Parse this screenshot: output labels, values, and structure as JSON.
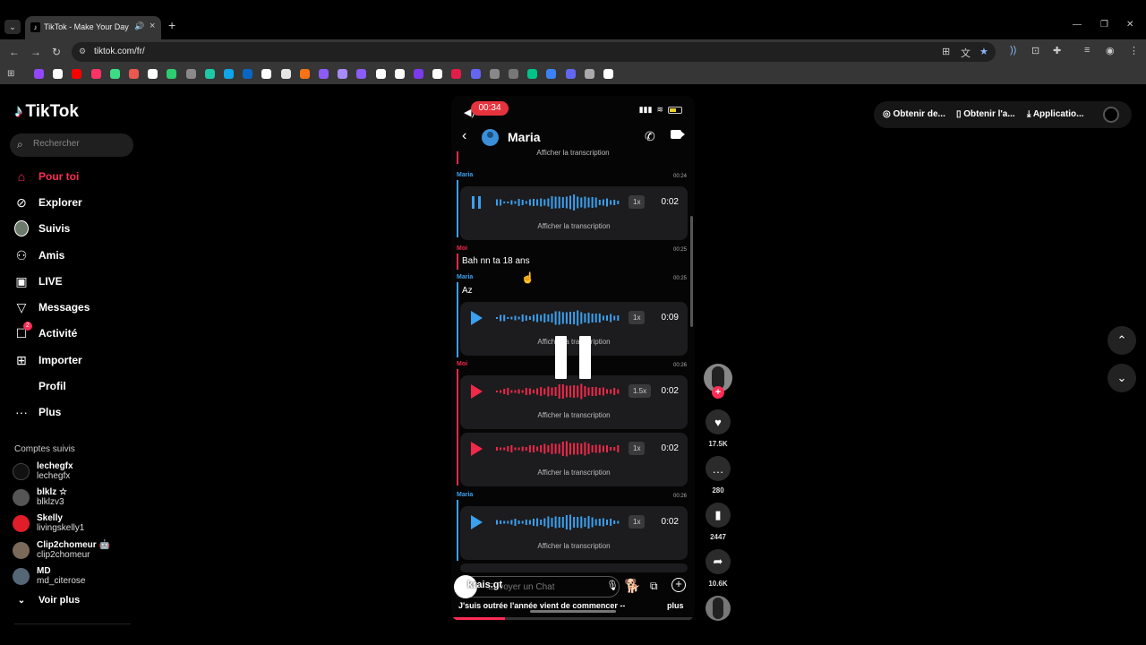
{
  "browser": {
    "tab_title": "TikTok - Make Your Day",
    "url": "tiktok.com/fr/",
    "bookmark_colors": [
      "#9147ff",
      "#ffffff",
      "#ff0000",
      "#ff3366",
      "#3ddc84",
      "#e95950",
      "#ffffff",
      "#2ecc71",
      "#8a8a8a",
      "#1ec8a5",
      "#0ea5e9",
      "#0a66c2",
      "#ffffff",
      "#e5e5e5",
      "#f97316",
      "#8b5cf6",
      "#a78bfa",
      "#8b5cf6",
      "#ffffff",
      "#ffffff",
      "#7c3aed",
      "#ffffff",
      "#e11d48",
      "#6366f1",
      "#888888",
      "#777777",
      "#00c389",
      "#3b82f6",
      "#6366f1",
      "#aaaaaa",
      "#ffffff"
    ]
  },
  "sidebar": {
    "logo": "TikTok",
    "search_placeholder": "Rechercher",
    "nav": [
      {
        "label": "Pour toi",
        "icon": "home-icon"
      },
      {
        "label": "Explorer",
        "icon": "compass-icon"
      },
      {
        "label": "Suivis",
        "icon": "following-avatar-icon"
      },
      {
        "label": "Amis",
        "icon": "friends-icon"
      },
      {
        "label": "LIVE",
        "icon": "live-icon"
      },
      {
        "label": "Messages",
        "icon": "messages-icon"
      },
      {
        "label": "Activité",
        "icon": "activity-icon",
        "badge": "2"
      },
      {
        "label": "Importer",
        "icon": "upload-icon"
      },
      {
        "label": "Profil",
        "icon": "profile-icon"
      },
      {
        "label": "Plus",
        "icon": "more-icon"
      }
    ],
    "following_title": "Comptes suivis",
    "following": [
      {
        "display": "lechegfx",
        "username": "lechegfx",
        "color": "#111111"
      },
      {
        "display": "blklz ☆",
        "username": "blklzv3",
        "color": "#555555"
      },
      {
        "display": "Skelly",
        "username": "livingskelly1",
        "color": "#e11d2a"
      },
      {
        "display": "Clip2chomeur 🤖",
        "username": "clip2chomeur",
        "color": "#7a6a5a"
      },
      {
        "display": "MD",
        "username": "md_citerose",
        "color": "#556677"
      }
    ],
    "see_more": "Voir plus"
  },
  "video": {
    "recording_time": "00:34",
    "contact_name": "Maria",
    "transcript_label": "Afficher la transcription",
    "text_messages": {
      "moi_1": "Bah nn ta 18 ans",
      "maria_1": "Az"
    },
    "labels": {
      "maria": "Maria",
      "moi": "Moi"
    },
    "times": {
      "t1": "00:24",
      "t2": "00:25",
      "t3": "00:25",
      "t4": "00:26",
      "t5": "00:26"
    },
    "voice_notes": [
      {
        "sender": "maria",
        "speed": "1x",
        "duration": "0:02",
        "state": "playing"
      },
      {
        "sender": "maria",
        "speed": "1x",
        "duration": "0:09",
        "state": "paused"
      },
      {
        "sender": "moi",
        "speed": "1.5x",
        "duration": "0:02",
        "state": "paused"
      },
      {
        "sender": "moi",
        "speed": "1x",
        "duration": "0:02",
        "state": "paused"
      },
      {
        "sender": "maria",
        "speed": "1x",
        "duration": "0:02",
        "state": "paused"
      }
    ],
    "chat_placeholder": "Envoyer un Chat",
    "author": "krais.gt",
    "caption": "J'suis outrée l'année vient de commencer --",
    "more": "plus",
    "progress": 0.22,
    "colors": {
      "maria": "#3aa0f0",
      "moi": "#f0284a"
    }
  },
  "actions": {
    "likes": "17.5K",
    "comments": "280",
    "saves": "2447",
    "shares": "10.6K"
  },
  "top_right": {
    "coins": "Obtenir de...",
    "app": "Obtenir l'a...",
    "download": "Applicatio..."
  }
}
